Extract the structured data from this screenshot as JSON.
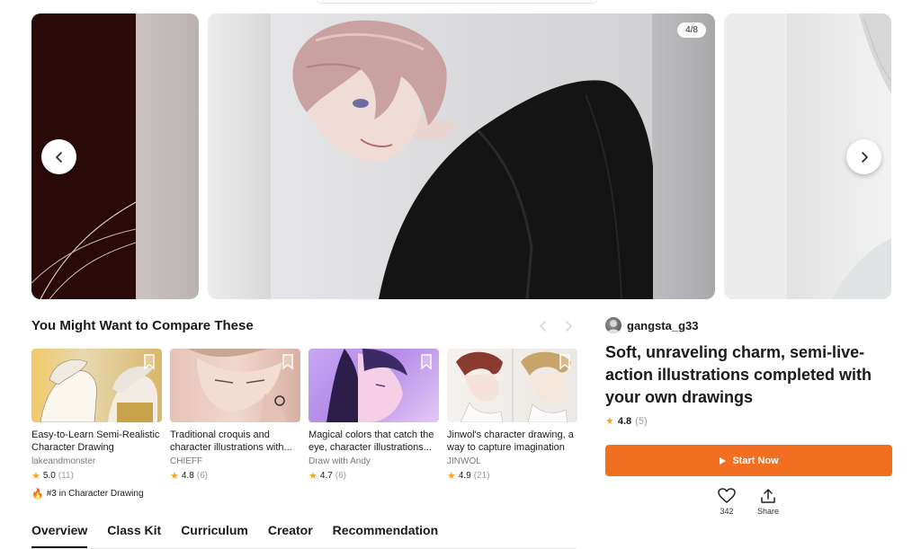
{
  "carousel": {
    "counter": "4/8",
    "prev_icon": "chevron-left-icon",
    "next_icon": "chevron-right-icon"
  },
  "compare": {
    "title": "You Might Want to Compare These",
    "cards": [
      {
        "title": "Easy-to-Learn Semi-Realistic Character Drawing",
        "author": "lakeandmonster",
        "rating": "5.0",
        "count": "(11)"
      },
      {
        "title": "Traditional croquis and character illustrations with...",
        "author": "CHIEFF",
        "rating": "4.8",
        "count": "(6)"
      },
      {
        "title": "Magical colors that catch the eye, character illustrations...",
        "author": "Draw with Andy",
        "rating": "4.7",
        "count": "(6)"
      },
      {
        "title": "Jinwol's character drawing, a way to capture imagination",
        "author": "JINWOL",
        "rating": "4.9",
        "count": "(21)"
      }
    ],
    "rank_badge": "#3 in Character Drawing"
  },
  "tabs": [
    "Overview",
    "Class Kit",
    "Curriculum",
    "Creator",
    "Recommendation"
  ],
  "class_info": {
    "creator": "gangsta_g33",
    "title": "Soft, unraveling charm, semi-live-action illustrations completed with your own drawings",
    "rating": "4.8",
    "rating_count": "(5)",
    "start_label": "Start Now",
    "likes": "342",
    "share_label": "Share"
  },
  "colors": {
    "accent": "#f26f21",
    "star": "#f5a623"
  }
}
